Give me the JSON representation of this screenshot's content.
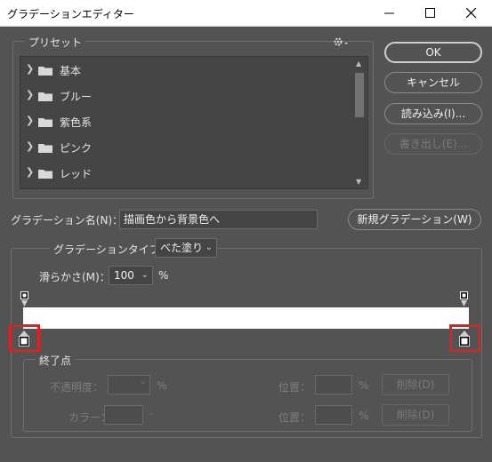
{
  "window": {
    "title": "グラデーションエディター"
  },
  "presets": {
    "legend": "プリセット",
    "items": [
      {
        "label": "基本"
      },
      {
        "label": "ブルー"
      },
      {
        "label": "紫色系"
      },
      {
        "label": "ピンク"
      },
      {
        "label": "レッド"
      }
    ]
  },
  "buttons": {
    "ok": "OK",
    "cancel": "キャンセル",
    "load": "読み込み(I)...",
    "save": "書き出し(E)...",
    "new": "新規グラデーション(W)"
  },
  "name": {
    "label": "グラデーション名(N)：",
    "value": "描画色から背景色へ"
  },
  "gradient_type": {
    "label": "グラデーションタイプ：",
    "value": "べた塗り"
  },
  "smoothness": {
    "label": "滑らかさ(M)：",
    "value": "100",
    "unit": "%"
  },
  "stops": {
    "legend": "終了点",
    "opacity_label": "不透明度：",
    "percent": "%",
    "color_label": "カラー：",
    "location_label": "位置：",
    "delete_label": "削除(D)"
  },
  "colors": {
    "background": "#535353",
    "highlight": "#e02020",
    "gradient_start": "#ffffff",
    "gradient_end": "#ffffff"
  }
}
